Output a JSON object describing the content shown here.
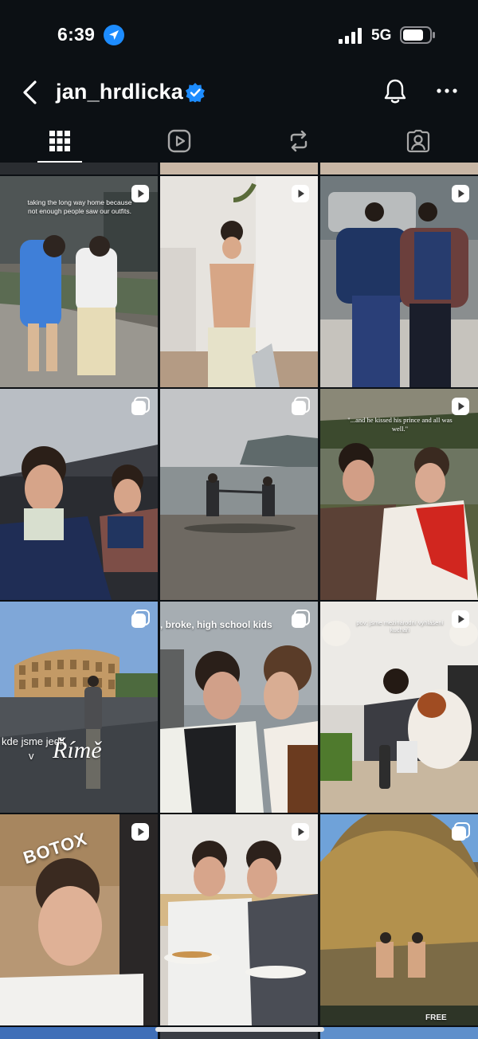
{
  "status_bar": {
    "time": "6:39",
    "network": "5G",
    "location_icon": "location-arrow-icon",
    "accent": "#1d8cff"
  },
  "nav": {
    "username": "jan_hrdlicka",
    "verified_color": "#1d8cff"
  },
  "tabs": [
    {
      "name": "posts-grid",
      "icon": "grid-icon",
      "selected": true
    },
    {
      "name": "reels",
      "icon": "reels-icon",
      "selected": false
    },
    {
      "name": "reposts",
      "icon": "repost-icon",
      "selected": false
    },
    {
      "name": "tagged",
      "icon": "tagged-person-icon",
      "selected": false
    }
  ],
  "posts": [
    {
      "type": "reel",
      "caption": "taking the long way home because not enough people saw our outfits."
    },
    {
      "type": "reel",
      "caption": ""
    },
    {
      "type": "reel",
      "caption": ""
    },
    {
      "type": "carousel",
      "caption": ""
    },
    {
      "type": "carousel",
      "caption": ""
    },
    {
      "type": "reel",
      "caption": "\"...and he kissed his prince and all was well.\""
    },
    {
      "type": "carousel",
      "caption_a": "kde jsme jedli",
      "caption_b": "v",
      "caption_c": "Římě"
    },
    {
      "type": "carousel",
      "caption": ", broke, high school kids"
    },
    {
      "type": "reel",
      "caption": "pov: jsme mezinárodní vyhlášení kuchaři"
    },
    {
      "type": "reel",
      "caption": "BOTOX"
    },
    {
      "type": "reel",
      "caption": ""
    },
    {
      "type": "carousel",
      "caption": "FREE"
    }
  ]
}
